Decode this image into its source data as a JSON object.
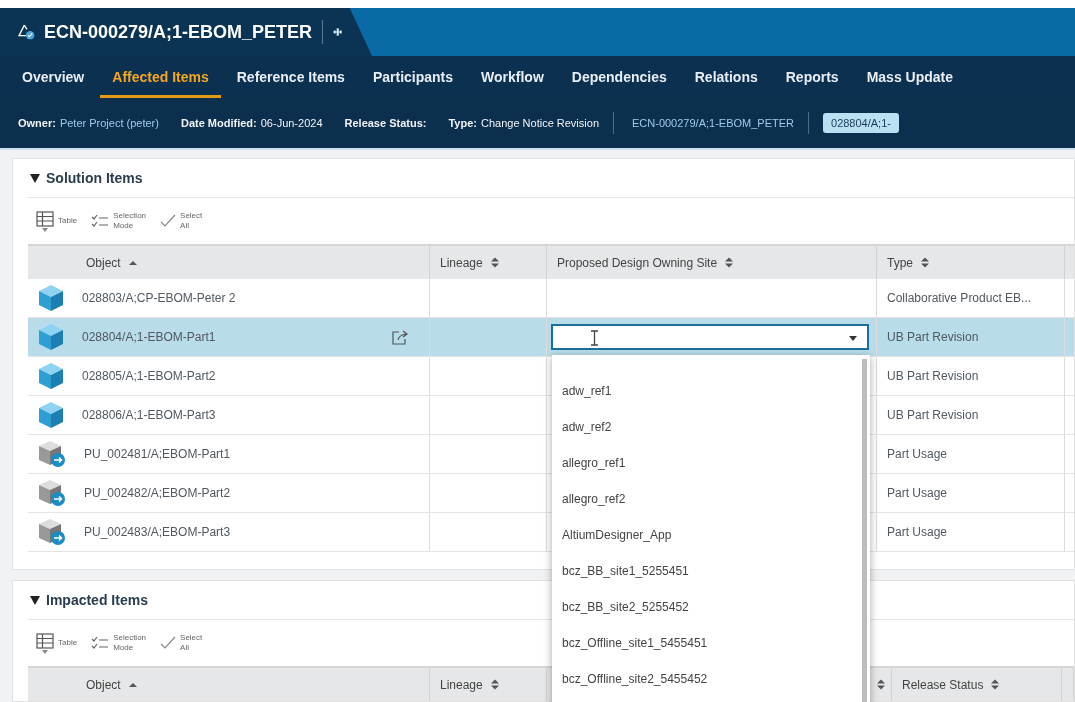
{
  "window": {
    "title": "ECN-000279/A;1-EBOM_PETER"
  },
  "tabs": [
    {
      "label": "Overview",
      "selected": false
    },
    {
      "label": "Affected Items",
      "selected": true
    },
    {
      "label": "Reference Items",
      "selected": false
    },
    {
      "label": "Participants",
      "selected": false
    },
    {
      "label": "Workflow",
      "selected": false
    },
    {
      "label": "Dependencies",
      "selected": false
    },
    {
      "label": "Relations",
      "selected": false
    },
    {
      "label": "Reports",
      "selected": false
    },
    {
      "label": "Mass Update",
      "selected": false
    }
  ],
  "info_bar": {
    "owner": {
      "label": "Owner:",
      "value": "Peter Project (peter)"
    },
    "date_modified": {
      "label": "Date Modified:",
      "value": "06-Jun-2024"
    },
    "release_status": {
      "label": "Release Status:"
    },
    "type": {
      "label": "Type:",
      "value": "Change Notice Revision"
    },
    "link": "ECN-000279/A;1-EBOM_PETER",
    "chip": "028804/A;1-"
  },
  "solution_items": {
    "title": "Solution Items",
    "expanded": true,
    "toolbar": [
      {
        "kind": "table",
        "label": "Table"
      },
      {
        "kind": "selection",
        "label": "Selection Mode"
      },
      {
        "kind": "select_all",
        "label": "Select All"
      }
    ],
    "columns": [
      {
        "label": "Object",
        "sorted": true
      },
      {
        "label": "Lineage",
        "sorted": false
      },
      {
        "label": "Proposed Design Owning Site",
        "sorted": false
      },
      {
        "label": "Type",
        "sorted": false
      }
    ],
    "rows": [
      {
        "kind": "part",
        "object": "028803/A;CP-EBOM-Peter 2",
        "type": "Collaborative Product EB...",
        "selected": false,
        "editing": false
      },
      {
        "kind": "part",
        "object": "028804/A;1-EBOM-Part1",
        "type": "UB Part Revision",
        "selected": true,
        "editing": true
      },
      {
        "kind": "part",
        "object": "028805/A;1-EBOM-Part2",
        "type": "UB Part Revision",
        "selected": false,
        "editing": false
      },
      {
        "kind": "part",
        "object": "028806/A;1-EBOM-Part3",
        "type": "UB Part Revision",
        "selected": false,
        "editing": false
      },
      {
        "kind": "usage",
        "object": "PU_002481/A;EBOM-Part1",
        "type": "Part Usage",
        "selected": false,
        "editing": false
      },
      {
        "kind": "usage",
        "object": "PU_002482/A;EBOM-Part2",
        "type": "Part Usage",
        "selected": false,
        "editing": false
      },
      {
        "kind": "usage",
        "object": "PU_002483/A;EBOM-Part3",
        "type": "Part Usage",
        "selected": false,
        "editing": false
      }
    ],
    "dropdown_options": [
      "adw_ref1",
      "adw_ref2",
      "allegro_ref1",
      "allegro_ref2",
      "AltiumDesigner_App",
      "bcz_BB_site1_5255451",
      "bcz_BB_site2_5255452",
      "bcz_Offline_site1_5455451",
      "bcz_Offline_site2_5455452"
    ]
  },
  "impacted_items": {
    "title": "Impacted Items",
    "expanded": true,
    "toolbar": [
      {
        "kind": "table",
        "label": "Table"
      },
      {
        "kind": "selection",
        "label": "Selection Mode"
      },
      {
        "kind": "select_all",
        "label": "Select All"
      }
    ],
    "columns": [
      {
        "label": "Object",
        "sorted": true
      },
      {
        "label": "Lineage",
        "sorted": false
      },
      {
        "sorted": false
      },
      {
        "label": "Release Status",
        "sorted": false
      }
    ]
  }
}
